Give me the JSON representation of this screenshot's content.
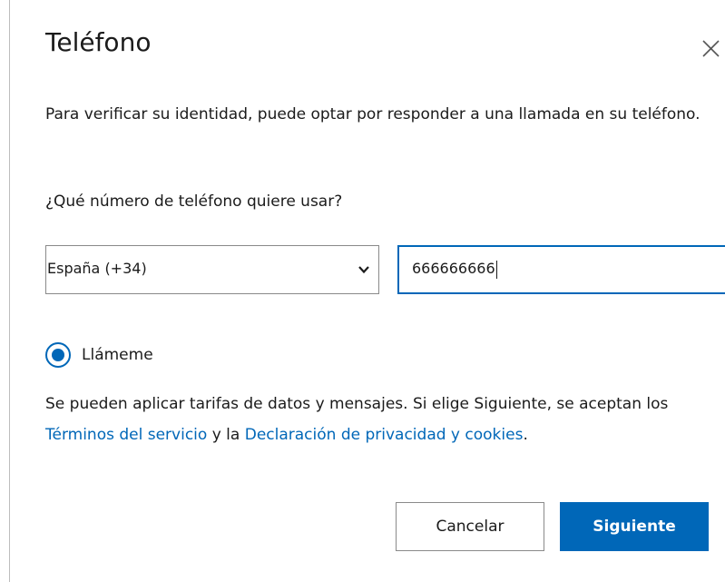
{
  "dialog": {
    "title": "Teléfono",
    "intro": "Para verificar su identidad, puede optar por responder a una llamada en su teléfono.",
    "question": "¿Qué número de teléfono quiere usar?"
  },
  "country_select": {
    "selected": "España (+34)"
  },
  "phone_input": {
    "value": "666666666"
  },
  "radio": {
    "label": "Llámeme",
    "checked": true
  },
  "disclaimer": {
    "part1": "Se pueden aplicar tarifas de datos y mensajes. Si elige Siguiente, se aceptan los ",
    "terms_link": "Términos del servicio",
    "part2": " y la ",
    "privacy_link": "Declaración de privacidad y cookies",
    "part3": "."
  },
  "buttons": {
    "cancel": "Cancelar",
    "next": "Siguiente"
  },
  "icons": {
    "close": "close-icon",
    "dropdown": "chevron-down-icon"
  },
  "colors": {
    "accent": "#0067b8",
    "text": "#1b1b1b",
    "border": "#8a8a8a"
  }
}
